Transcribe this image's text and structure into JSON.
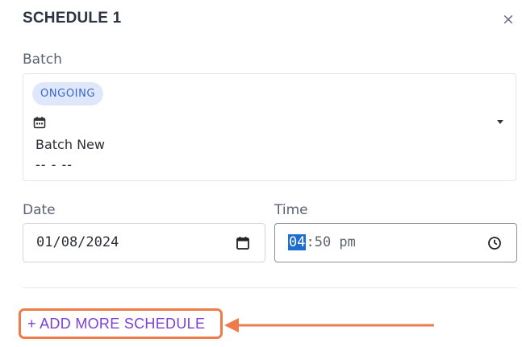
{
  "header": {
    "title": "SCHEDULE 1",
    "close_icon": "×"
  },
  "batch": {
    "label": "Batch",
    "status_chip": "ONGOING",
    "icon": "calendar-icon",
    "name": "Batch New",
    "dates": "-- - --"
  },
  "date_field": {
    "label": "Date",
    "value": "01/08/2024",
    "icon": "calendar-icon"
  },
  "time_field": {
    "label": "Time",
    "hour": "04",
    "rest": ":50 pm",
    "icon": "clock-icon"
  },
  "actions": {
    "add_more": "+ ADD MORE SCHEDULE"
  },
  "annotation": {
    "arrow_color": "#ef7a4a",
    "highlight_color": "#ef7a4a"
  }
}
